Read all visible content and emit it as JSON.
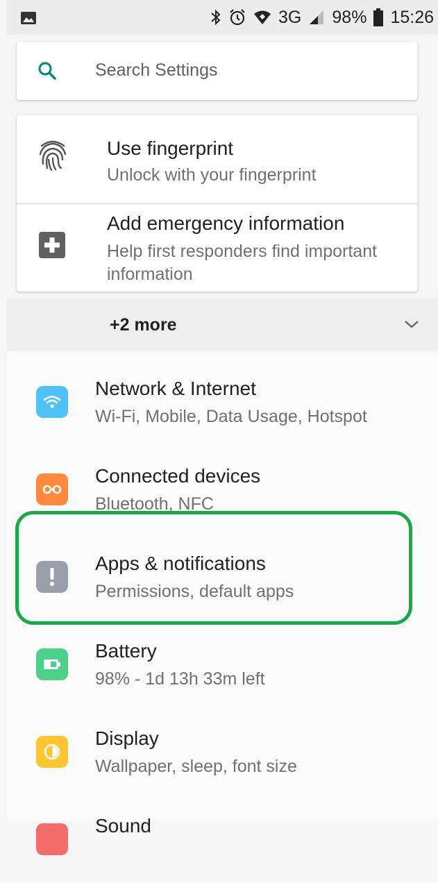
{
  "status_bar": {
    "icons": [
      "image-icon",
      "bluetooth-icon",
      "alarm-icon",
      "wifi-icon",
      "signal-icon",
      "battery-icon"
    ],
    "network": "3G",
    "battery": "98%",
    "time": "15:26"
  },
  "search": {
    "placeholder": "Search Settings"
  },
  "suggestions": [
    {
      "title": "Use fingerprint",
      "subtitle": "Unlock with your fingerprint",
      "icon": "fingerprint-icon"
    },
    {
      "title": "Add emergency information",
      "subtitle": "Help first responders find important information",
      "icon": "emergency-add-icon"
    }
  ],
  "more": {
    "label": "+2 more"
  },
  "settings": [
    {
      "title": "Network & Internet",
      "subtitle": "Wi-Fi, Mobile, Data Usage, Hotspot",
      "icon": "wifi-icon",
      "color": "#4fc3f7"
    },
    {
      "title": "Connected devices",
      "subtitle": "Bluetooth, NFC",
      "icon": "connected-devices-icon",
      "color": "#ff8a3d"
    },
    {
      "title": "Apps & notifications",
      "subtitle": "Permissions, default apps",
      "icon": "apps-notifications-icon",
      "color": "#9aa0ab"
    },
    {
      "title": "Battery",
      "subtitle": "98% - 1d 13h 33m left",
      "icon": "battery-icon",
      "color": "#4cd08a"
    },
    {
      "title": "Display",
      "subtitle": "Wallpaper, sleep, font size",
      "icon": "display-icon",
      "color": "#fcc531"
    },
    {
      "title": "Sound",
      "icon": "sound-icon",
      "color": "#f46b6b"
    }
  ],
  "highlight_color": "#1aa84a"
}
